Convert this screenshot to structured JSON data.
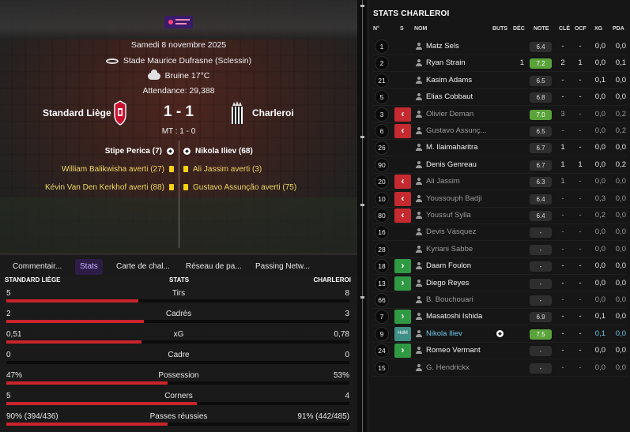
{
  "match": {
    "date": "Samedi 8 novembre 2025",
    "stadium": "Stade Maurice Dufrasne (Sclessin)",
    "weather": "Bruine 17°C",
    "attendance": "Attendance: 29,388",
    "home_team": "Standard Liège",
    "away_team": "Charleroi",
    "score": "1 - 1",
    "halftime": "MT : 1 - 0",
    "events": [
      {
        "side": "home",
        "type": "goal",
        "text": "Stipe Perica (7)"
      },
      {
        "side": "away",
        "type": "goal",
        "text": "Nikola Iliev (68)"
      },
      {
        "side": "home",
        "type": "card",
        "text": "William Balikwisha averti (27)"
      },
      {
        "side": "away",
        "type": "card",
        "text": "Ali Jassim averti (3)"
      },
      {
        "side": "home",
        "type": "card",
        "text": "Kévin Van Den Kerkhof averti (88)"
      },
      {
        "side": "away",
        "type": "card",
        "text": "Gustavo Assunção averti (75)"
      }
    ]
  },
  "tabs": [
    "Commentair...",
    "Stats",
    "Carte de chal...",
    "Réseau de pa...",
    "Passing Netw..."
  ],
  "active_tab": 1,
  "stats": {
    "header": {
      "home": "STANDARD LIÈGE",
      "middle": "STATS",
      "away": "CHARLEROI"
    },
    "rows": [
      {
        "label": "Tirs",
        "home": "5",
        "away": "8",
        "home_share": 0.385
      },
      {
        "label": "Cadrés",
        "home": "2",
        "away": "3",
        "home_share": 0.4
      },
      {
        "label": "xG",
        "home": "0,51",
        "away": "0,78",
        "home_share": 0.395
      },
      {
        "label": "Cadre",
        "home": "0",
        "away": "0",
        "home_share": 0.0
      },
      {
        "label": "Possession",
        "home": "47%",
        "away": "53%",
        "home_share": 0.47
      },
      {
        "label": "Corners",
        "home": "5",
        "away": "4",
        "home_share": 0.555
      },
      {
        "label": "Passes réussies",
        "home": "90% (394/436)",
        "away": "91% (442/485)",
        "home_share": 0.47
      }
    ],
    "accent": "#c9252b"
  },
  "right_panel": {
    "title": "STATS CHARLEROI",
    "columns": [
      "N°",
      "S",
      "NOM",
      "BUTS",
      "DÉC",
      "NOTE",
      "CLÉ",
      "OCF",
      "XG",
      "PDA"
    ],
    "players": [
      {
        "num": "1",
        "sub": "",
        "name": "Matz Sels",
        "buts": "",
        "dec": "",
        "note": "6.4",
        "note_good": false,
        "cle": "-",
        "ocf": "-",
        "xg": "0,0",
        "pda": "0,0",
        "dim": false
      },
      {
        "num": "2",
        "sub": "",
        "name": "Ryan Strain",
        "buts": "",
        "dec": "1",
        "note": "7.2",
        "note_good": true,
        "cle": "2",
        "ocf": "1",
        "xg": "0,0",
        "pda": "0,1",
        "dim": false
      },
      {
        "num": "21",
        "sub": "",
        "name": "Kasim Adams",
        "buts": "",
        "dec": "",
        "note": "6.5",
        "note_good": false,
        "cle": "-",
        "ocf": "-",
        "xg": "0,1",
        "pda": "0,0",
        "dim": false
      },
      {
        "num": "5",
        "sub": "",
        "name": "Elias Cobbaut",
        "buts": "",
        "dec": "",
        "note": "6.8",
        "note_good": false,
        "cle": "-",
        "ocf": "-",
        "xg": "0,0",
        "pda": "0,0",
        "dim": false
      },
      {
        "num": "3",
        "sub": "out",
        "name": "Olivier Deman",
        "buts": "",
        "dec": "",
        "note": "7.0",
        "note_good": true,
        "cle": "3",
        "ocf": "-",
        "xg": "0,0",
        "pda": "0,2",
        "dim": true
      },
      {
        "num": "6",
        "sub": "out",
        "name": "Gustavo Assunç...",
        "buts": "",
        "dec": "",
        "note": "6.5",
        "note_good": false,
        "cle": "-",
        "ocf": "-",
        "xg": "0,0",
        "pda": "0,2",
        "dim": true
      },
      {
        "num": "26",
        "sub": "",
        "name": "M. Ilaimaharitra",
        "buts": "",
        "dec": "",
        "note": "6.7",
        "note_good": false,
        "cle": "1",
        "ocf": "-",
        "xg": "0,0",
        "pda": "0,0",
        "dim": false
      },
      {
        "num": "90",
        "sub": "",
        "name": "Denis Genreau",
        "buts": "",
        "dec": "",
        "note": "6.7",
        "note_good": false,
        "cle": "1",
        "ocf": "1",
        "xg": "0,0",
        "pda": "0,2",
        "dim": false
      },
      {
        "num": "20",
        "sub": "out",
        "name": "Ali Jassim",
        "buts": "",
        "dec": "",
        "note": "6.3",
        "note_good": false,
        "cle": "1",
        "ocf": "-",
        "xg": "0,0",
        "pda": "0,0",
        "dim": true
      },
      {
        "num": "10",
        "sub": "out",
        "name": "Youssouph Badji",
        "buts": "",
        "dec": "",
        "note": "6.4",
        "note_good": false,
        "cle": "-",
        "ocf": "-",
        "xg": "0,3",
        "pda": "0,0",
        "dim": true
      },
      {
        "num": "80",
        "sub": "out",
        "name": "Youssuf Sylla",
        "buts": "",
        "dec": "",
        "note": "6.4",
        "note_good": false,
        "cle": "-",
        "ocf": "-",
        "xg": "0,2",
        "pda": "0,0",
        "dim": true
      },
      {
        "num": "16",
        "sub": "",
        "name": "Devis Vásquez",
        "buts": "",
        "dec": "",
        "note": "-",
        "note_good": false,
        "cle": "-",
        "ocf": "-",
        "xg": "0,0",
        "pda": "0,0",
        "dim": true
      },
      {
        "num": "28",
        "sub": "",
        "name": "Kyriani Sabbe",
        "buts": "",
        "dec": "",
        "note": "-",
        "note_good": false,
        "cle": "-",
        "ocf": "-",
        "xg": "0,0",
        "pda": "0,0",
        "dim": true
      },
      {
        "num": "18",
        "sub": "in",
        "name": "Daam Foulon",
        "buts": "",
        "dec": "",
        "note": "-",
        "note_good": false,
        "cle": "-",
        "ocf": "-",
        "xg": "0,0",
        "pda": "0,0",
        "dim": false
      },
      {
        "num": "13",
        "sub": "in",
        "name": "Diego Reyes",
        "buts": "",
        "dec": "",
        "note": "-",
        "note_good": false,
        "cle": "-",
        "ocf": "-",
        "xg": "0,0",
        "pda": "0,0",
        "dim": false
      },
      {
        "num": "66",
        "sub": "",
        "name": "B. Bouchouari",
        "buts": "",
        "dec": "",
        "note": "-",
        "note_good": false,
        "cle": "-",
        "ocf": "-",
        "xg": "0,0",
        "pda": "0,0",
        "dim": true
      },
      {
        "num": "7",
        "sub": "in",
        "name": "Masatoshi Ishida",
        "buts": "",
        "dec": "",
        "note": "6.9",
        "note_good": false,
        "cle": "-",
        "ocf": "-",
        "xg": "0,1",
        "pda": "0,0",
        "dim": false
      },
      {
        "num": "9",
        "sub": "hdm",
        "name": "Nikola Iliev",
        "buts": "goal",
        "dec": "",
        "note": "7.5",
        "note_good": true,
        "cle": "-",
        "ocf": "-",
        "xg": "0,1",
        "pda": "0,0",
        "dim": false,
        "motm": true
      },
      {
        "num": "24",
        "sub": "in",
        "name": "Romeo Vermant",
        "buts": "",
        "dec": "",
        "note": "-",
        "note_good": false,
        "cle": "-",
        "ocf": "-",
        "xg": "0,0",
        "pda": "0,0",
        "dim": false
      },
      {
        "num": "15",
        "sub": "",
        "name": "G. Hendrickx",
        "buts": "",
        "dec": "",
        "note": "-",
        "note_good": false,
        "cle": "-",
        "ocf": "-",
        "xg": "0,0",
        "pda": "0,0",
        "dim": true
      }
    ],
    "hdm_label": "HdM"
  },
  "colors": {
    "accent_purple": "#2c1c46",
    "good_note": "#5aa33a",
    "sub_out": "#c42a2f",
    "sub_in": "#2f9a43",
    "yellow_card": "#f5d20f"
  }
}
